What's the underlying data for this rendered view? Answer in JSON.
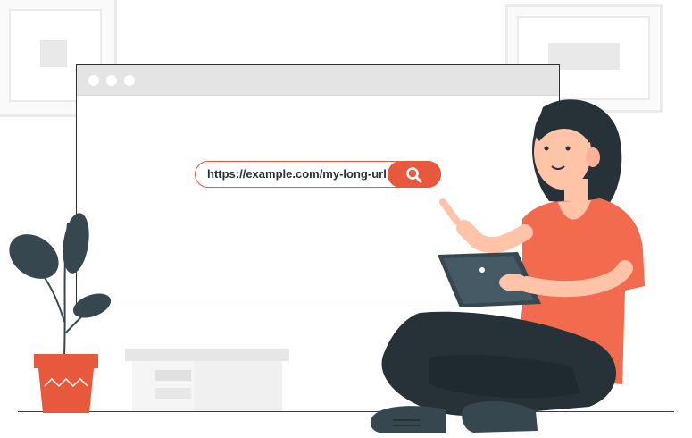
{
  "browser": {
    "url": "https://example.com/my-long-url",
    "search_icon": "search-icon",
    "window_dots": [
      "dot",
      "dot",
      "dot"
    ]
  },
  "colors": {
    "accent": "#e8583d",
    "dark": "#263238",
    "shirt": "#f26b4f",
    "skin": "#ffc3a8",
    "plant": "#37474f"
  }
}
